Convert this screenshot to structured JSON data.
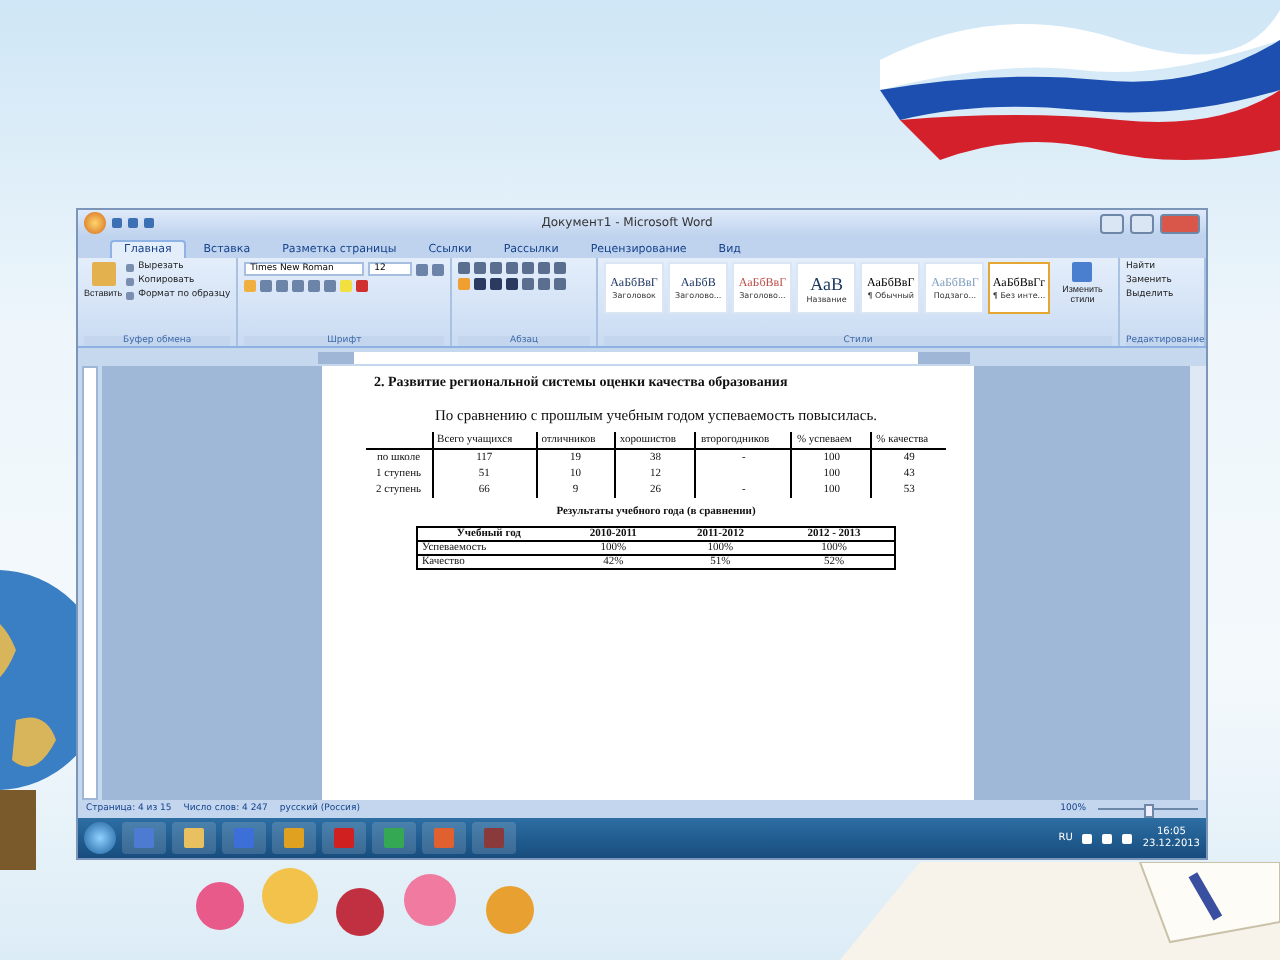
{
  "window": {
    "title": "Документ1 - Microsoft Word"
  },
  "ribbon_tabs": [
    {
      "label": "Главная",
      "selected": true
    },
    {
      "label": "Вставка",
      "selected": false
    },
    {
      "label": "Разметка страницы",
      "selected": false
    },
    {
      "label": "Ссылки",
      "selected": false
    },
    {
      "label": "Рассылки",
      "selected": false
    },
    {
      "label": "Рецензирование",
      "selected": false
    },
    {
      "label": "Вид",
      "selected": false
    }
  ],
  "clipboard": {
    "paste": "Вставить",
    "items": [
      "Вырезать",
      "Копировать",
      "Формат по образцу"
    ],
    "group": "Буфер обмена"
  },
  "font": {
    "name": "Times New Roman",
    "size": "12",
    "group": "Шрифт"
  },
  "paragraph": {
    "group": "Абзац"
  },
  "styles": {
    "items": [
      {
        "sample": "АаБбВвГ",
        "label": "Заголовок",
        "selected": false,
        "color": "#1f3864"
      },
      {
        "sample": "АаБбВ",
        "label": "Заголово...",
        "selected": false,
        "color": "#1f3864"
      },
      {
        "sample": "АаБбВвГ",
        "label": "Заголово...",
        "selected": false,
        "color": "#c0504d"
      },
      {
        "sample": "АаВ",
        "label": "Название",
        "selected": false,
        "color": "#17365d"
      },
      {
        "sample": "АаБбВвГ",
        "label": "¶ Обычный",
        "selected": false,
        "color": "#000000"
      },
      {
        "sample": "АаБбВвГ",
        "label": "Подзаго...",
        "selected": false,
        "color": "#7f9fbf"
      },
      {
        "sample": "АаБбВвГг",
        "label": "¶ Без инте...",
        "selected": true,
        "color": "#000000"
      }
    ],
    "group": "Стили",
    "change": "Изменить стили"
  },
  "editing": {
    "items": [
      "Найти",
      "Заменить",
      "Выделить"
    ],
    "group": "Редактирование"
  },
  "document": {
    "heading": "2.  Развитие региональной системы оценки качества образования",
    "lead": "По сравнению с прошлым учебным годом успеваемость повысилась.",
    "table1": {
      "columns": [
        "",
        "Всего учащихся",
        "отличников",
        "хорошистов",
        "второгодников",
        "% успеваем",
        "% качества"
      ],
      "rows": [
        [
          "по школе",
          "117",
          "19",
          "38",
          "-",
          "100",
          "49"
        ],
        [
          "1 ступень",
          "51",
          "10",
          "12",
          "",
          "100",
          "43"
        ],
        [
          "2 ступень",
          "66",
          "9",
          "26",
          "-",
          "100",
          "53"
        ]
      ]
    },
    "caption": "Результаты учебного года (в сравнении)",
    "table2": {
      "columns": [
        "Учебный год",
        "2010-2011",
        "2011-2012",
        "2012 - 2013"
      ],
      "rows": [
        [
          "Успеваемость",
          "100%",
          "100%",
          "100%"
        ],
        [
          "Качество",
          "42%",
          "51%",
          "52%"
        ]
      ]
    }
  },
  "status_bar": {
    "page": "Страница: 4 из 15",
    "words": "Число слов: 4 247",
    "language": "русский (Россия)",
    "zoom": "100%",
    "level": 0.5
  },
  "taskbar": {
    "language": "RU",
    "time": "16:05",
    "date": "23.12.2013"
  }
}
